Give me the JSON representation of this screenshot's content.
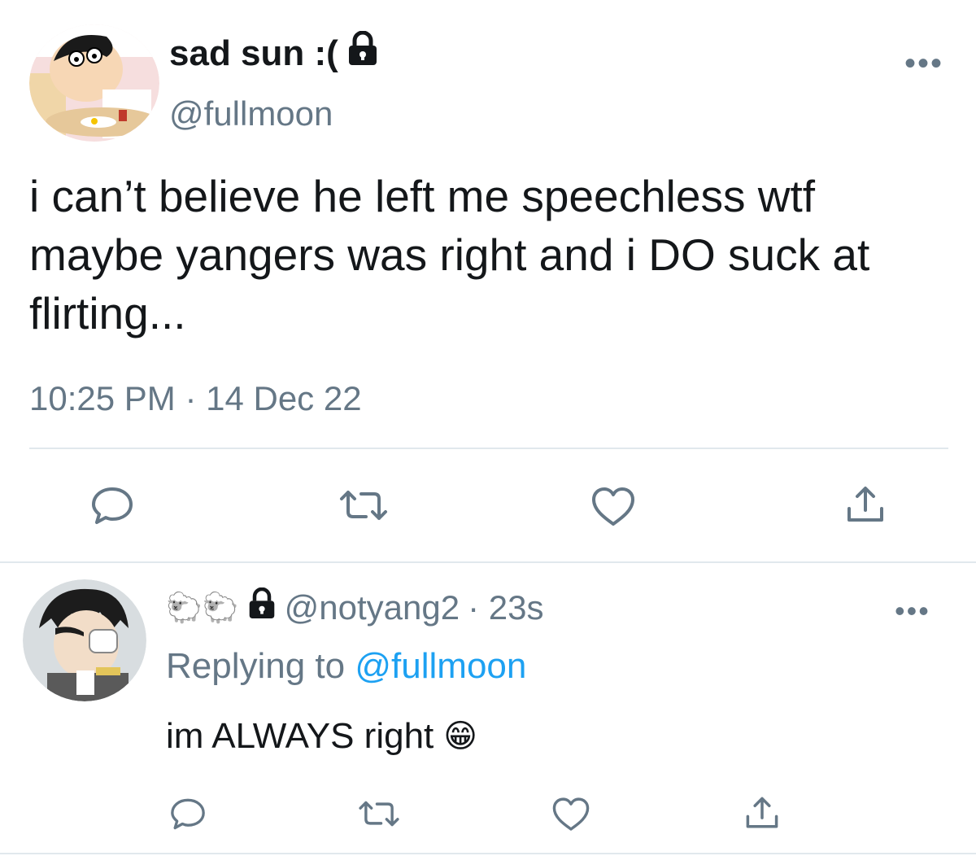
{
  "tweet": {
    "display_name": "sad sun :(",
    "handle": "@fullmoon",
    "text": "i can’t believe he left me speechless wtf maybe yangers was right and i DO suck at flirting...",
    "timestamp": "10:25 PM · 14 Dec 22",
    "more_icon": "•••",
    "icons": [
      "lock-icon",
      "reply-icon",
      "retweet-icon",
      "like-icon",
      "share-icon",
      "more-icon"
    ]
  },
  "reply": {
    "display_name": "🐑🐑",
    "handle": "@notyang2",
    "time": "· 23s",
    "replying_prefix": "Replying to",
    "replying_handle": "@fullmoon",
    "text": "im ALWAYS right",
    "emoji": "😁",
    "more_icon": "•••"
  },
  "colors": {
    "text": "#14171a",
    "secondary": "#657786",
    "link": "#1da1f2",
    "divider": "#e1e8ed",
    "icon": "#657786"
  }
}
